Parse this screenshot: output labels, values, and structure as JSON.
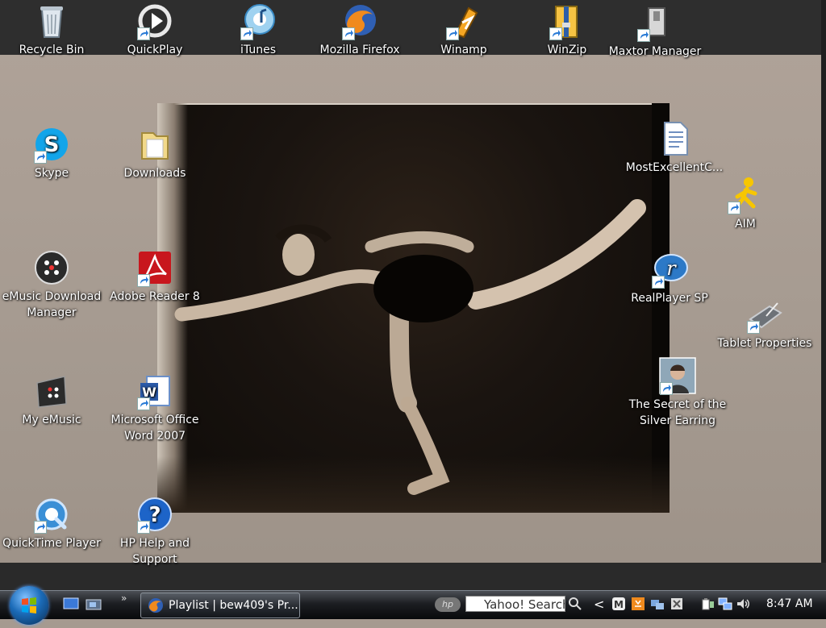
{
  "desktop_icons": {
    "recycle_bin": "Recycle Bin",
    "quickplay": "QuickPlay",
    "itunes": "iTunes",
    "firefox": "Mozilla Firefox",
    "winamp": "Winamp",
    "winzip": "WinZip",
    "maxtor": "Maxtor Manager",
    "skype": "Skype",
    "downloads": "Downloads",
    "document": "MostExcellentC...",
    "aim": "AIM",
    "emusic_dm_1": "eMusic Download",
    "emusic_dm_2": "Manager",
    "adobe": "Adobe Reader 8",
    "realplayer": "RealPlayer SP",
    "tablet": "Tablet Properties",
    "my_emusic": "My eMusic",
    "word_1": "Microsoft Office",
    "word_2": "Word 2007",
    "silver_1": "The Secret of the",
    "silver_2": "Silver Earring",
    "quicktime": "QuickTime Player",
    "hp_help_1": "HP Help and",
    "hp_help_2": "Support"
  },
  "taskbar": {
    "ql_chevron": "»",
    "task_button": "Playlist | bew409's Pr...",
    "hp_logo": "hp",
    "search_text": "Yahoo! Search",
    "tray_arrow": "<",
    "clock": "8:47 AM"
  },
  "colors": {
    "wallpaper": "#a69a90",
    "taskbar": "#1c1e22",
    "label_text": "#ffffff"
  }
}
